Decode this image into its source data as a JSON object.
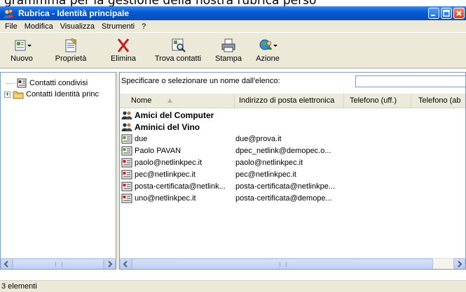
{
  "page_caption": "grammma per la gestione della nostra rubrica perso",
  "window": {
    "title": "Rubrica - Identità principale"
  },
  "menu": [
    "File",
    "Modifica",
    "Visualizza",
    "Strumenti",
    "?"
  ],
  "toolbar": [
    {
      "label": "Nuovo",
      "icon": "new-contact-icon"
    },
    {
      "label": "Proprietà",
      "icon": "properties-icon"
    },
    {
      "label": "Elimina",
      "icon": "delete-icon"
    },
    {
      "label": "Trova contatti",
      "icon": "find-contacts-icon"
    },
    {
      "label": "Stampa",
      "icon": "print-icon"
    },
    {
      "label": "Azione",
      "icon": "action-icon"
    }
  ],
  "tree": [
    {
      "label": "Contatti condivisi",
      "icon": "shared-contacts-icon"
    },
    {
      "label": "Contatti Identità princ",
      "icon": "folder-icon",
      "expander": "+"
    }
  ],
  "search": {
    "label": "Specificare o selezionare un nome dall'elenco:",
    "value": ""
  },
  "columns": [
    "Nome",
    "Indirizzo di posta elettronica",
    "Telefono (uff.)",
    "Telefono (ab"
  ],
  "rows": [
    {
      "name": "Amici del Computer",
      "email": "",
      "type": "group"
    },
    {
      "name": "Aminici del Vino",
      "email": "",
      "type": "group"
    },
    {
      "name": "due",
      "email": "due@prova.it",
      "type": "contact"
    },
    {
      "name": "Paolo PAVAN",
      "email": "dpec_netlink@demopec.o...",
      "type": "contact"
    },
    {
      "name": "paolo@netlinkpec.it",
      "email": "paolo@netlinkpec.it",
      "type": "cert"
    },
    {
      "name": "pec@netlinkpec.it",
      "email": "pec@netlinkpec.it",
      "type": "cert"
    },
    {
      "name": "posta-certificata@netlink...",
      "email": "posta-certificata@netlinkpe...",
      "type": "cert"
    },
    {
      "name": "uno@netlinkpec.it",
      "email": "posta-certificata@demope...",
      "type": "cert"
    }
  ],
  "status": "3 elementi",
  "colors": {
    "titlebar": "#0652c8",
    "chrome": "#ece9d8",
    "border": "#7f9db9",
    "delete": "#cc1a1a"
  }
}
